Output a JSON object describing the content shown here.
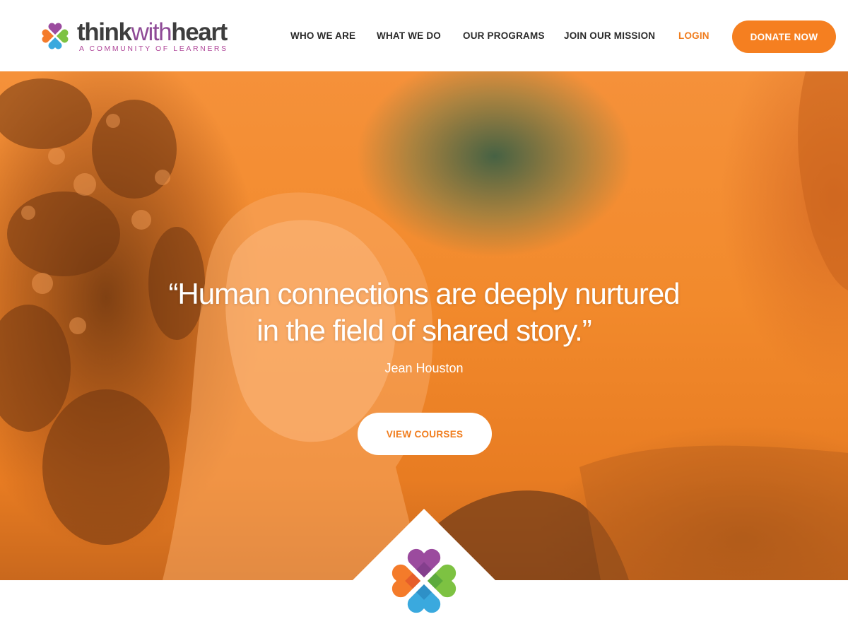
{
  "brand": {
    "word_think": "think",
    "word_with": "with",
    "word_heart": "heart",
    "tagline": "A COMMUNITY OF LEARNERS",
    "logo_icon": "heart-cross-icon"
  },
  "nav": {
    "items": [
      {
        "label": "WHO WE ARE"
      },
      {
        "label": "WHAT WE DO"
      },
      {
        "label": "OUR PROGRAMS"
      },
      {
        "label": "JOIN OUR MISSION"
      }
    ],
    "login": "LOGIN",
    "donate": "DONATE NOW"
  },
  "hero": {
    "quote_line1": "“Human connections are deeply nurtured",
    "quote_line2": "in the field of shared story.”",
    "author": "Jean Houston",
    "cta": "VIEW COURSES"
  },
  "colors": {
    "accent_orange": "#f57f20",
    "purple": "#9b4b9e",
    "green": "#7dc242",
    "blue": "#3aa9de",
    "orange": "#f47b2a"
  }
}
